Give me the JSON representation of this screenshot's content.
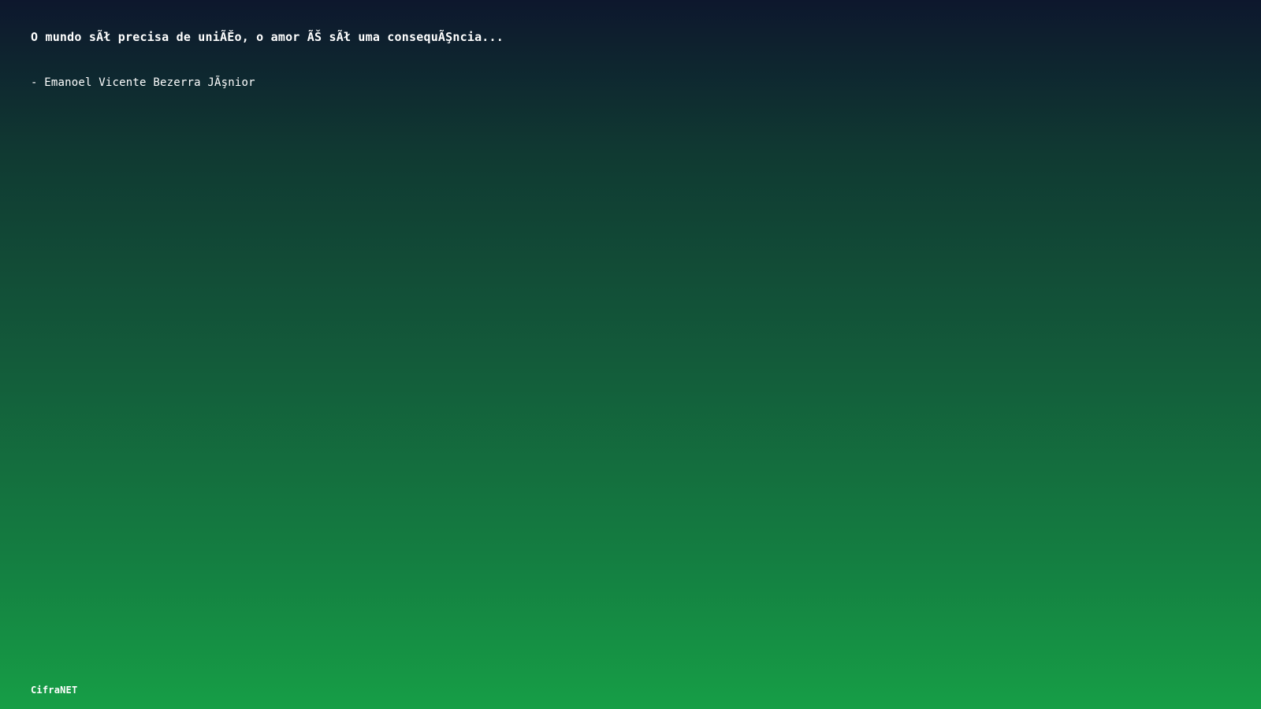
{
  "quote": {
    "text": "O mundo sÃł precisa de uniÃĚo, o amor ÃŠ sÃł uma consequÃŞncia...",
    "author": "- Emanoel Vicente Bezerra JÃşnior"
  },
  "footer": {
    "brand": "CifraNET"
  },
  "colors": {
    "gradient_top": "#0d172d",
    "gradient_bottom": "#169e46",
    "text": "#ffffff"
  }
}
